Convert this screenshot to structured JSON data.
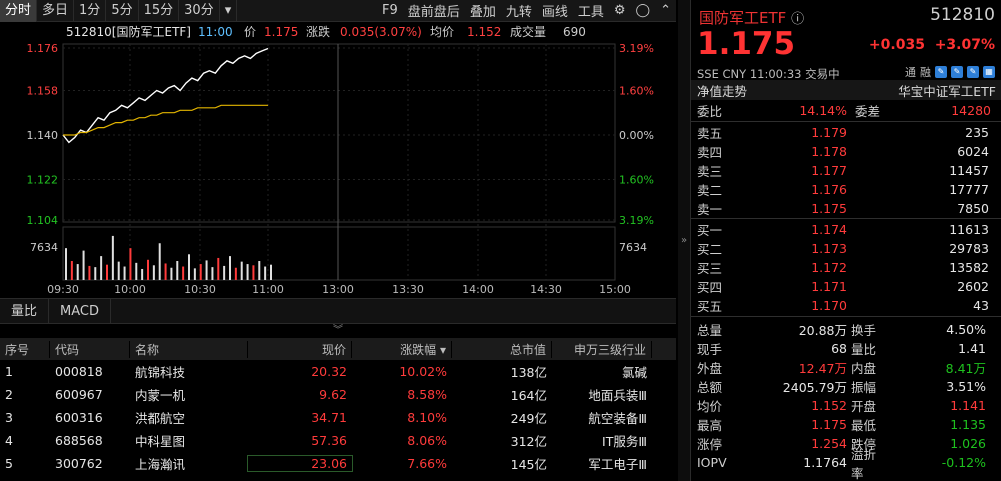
{
  "toolbar": {
    "tabs": [
      "分时",
      "多日",
      "1分",
      "5分",
      "15分",
      "30分"
    ],
    "tools": [
      "F9",
      "盘前盘后",
      "叠加",
      "九转",
      "画线",
      "工具"
    ]
  },
  "chart": {
    "header": {
      "code_name": "512810[国防军工ETF]",
      "time": "11:00",
      "price_label": "价",
      "price": "1.175",
      "chg_label": "涨跌",
      "chg": "0.035(3.07%)",
      "avg_label": "均价",
      "avg": "1.152",
      "vol_label": "成交量",
      "vol": "690"
    },
    "left_ticks": [
      "1.176",
      "1.158",
      "1.140",
      "1.122",
      "1.104"
    ],
    "right_ticks": [
      "3.19%",
      "1.60%",
      "0.00%",
      "1.60%",
      "3.19%"
    ],
    "vol_tick": "7634",
    "x_ticks": [
      "09:30",
      "10:00",
      "10:30",
      "11:00",
      "13:00",
      "13:30",
      "14:00",
      "14:30",
      "15:00"
    ]
  },
  "chart_data": {
    "type": "line",
    "ylim": [
      1.104,
      1.176
    ],
    "series": [
      {
        "name": "价",
        "values": [
          1.14,
          1.137,
          1.139,
          1.142,
          1.141,
          1.144,
          1.147,
          1.146,
          1.149,
          1.15,
          1.152,
          1.151,
          1.153,
          1.155,
          1.154,
          1.156,
          1.158,
          1.157,
          1.159,
          1.16,
          1.158,
          1.161,
          1.163,
          1.162,
          1.165,
          1.166,
          1.165,
          1.168,
          1.17,
          1.169,
          1.171,
          1.172,
          1.171,
          1.173,
          1.174,
          1.175
        ]
      },
      {
        "name": "均价",
        "values": [
          1.14,
          1.14,
          1.14,
          1.141,
          1.141,
          1.142,
          1.143,
          1.143,
          1.144,
          1.145,
          1.145,
          1.146,
          1.146,
          1.147,
          1.147,
          1.148,
          1.148,
          1.149,
          1.149,
          1.149,
          1.15,
          1.15,
          1.15,
          1.151,
          1.151,
          1.151,
          1.151,
          1.152,
          1.152,
          1.152,
          1.152,
          1.152,
          1.152,
          1.152,
          1.152,
          1.152
        ]
      }
    ],
    "volume": [
      5200,
      3100,
      2600,
      4800,
      2300,
      2100,
      3900,
      2500,
      7200,
      3000,
      2200,
      5200,
      2800,
      1800,
      3300,
      2400,
      6000,
      2700,
      2000,
      3100,
      2200,
      4200,
      1900,
      2600,
      3200,
      2100,
      3600,
      2300,
      3900,
      2000,
      3000,
      2600,
      2400,
      3100,
      2200,
      2500
    ]
  },
  "subtabs": [
    "量比",
    "MACD"
  ],
  "table": {
    "headers": [
      "序号",
      "代码",
      "名称",
      "现价",
      "涨跌幅 ▾",
      "总市值",
      "申万三级行业"
    ],
    "rows": [
      [
        "1",
        "000818",
        "航锦科技",
        "20.32",
        "10.02%",
        "138亿",
        "氯碱"
      ],
      [
        "2",
        "600967",
        "内蒙一机",
        "9.62",
        "8.58%",
        "164亿",
        "地面兵装Ⅲ"
      ],
      [
        "3",
        "600316",
        "洪都航空",
        "34.71",
        "8.10%",
        "249亿",
        "航空装备Ⅲ"
      ],
      [
        "4",
        "688568",
        "中科星图",
        "57.36",
        "8.06%",
        "312亿",
        "IT服务Ⅲ"
      ],
      [
        "5",
        "300762",
        "上海瀚讯",
        "23.06",
        "7.66%",
        "145亿",
        "军工电子Ⅲ"
      ]
    ]
  },
  "quote": {
    "name": "国防军工ETF",
    "code": "512810",
    "price": "1.175",
    "change": "+0.035",
    "pct": "+3.07%",
    "info": "SSE  CNY  11:00:33  交易中",
    "icons": [
      "通",
      "融"
    ],
    "section1": {
      "left": "净值走势",
      "right": "华宝中证军工ETF"
    },
    "wb": {
      "l1": "委比",
      "v1": "14.14%",
      "l2": "委差",
      "v2": "14280"
    },
    "asks": [
      [
        "卖五",
        "1.179",
        "235"
      ],
      [
        "卖四",
        "1.178",
        "6024"
      ],
      [
        "卖三",
        "1.177",
        "11457"
      ],
      [
        "卖二",
        "1.176",
        "17777"
      ],
      [
        "卖一",
        "1.175",
        "7850"
      ]
    ],
    "bids": [
      [
        "买一",
        "1.174",
        "11613"
      ],
      [
        "买二",
        "1.173",
        "29783"
      ],
      [
        "买三",
        "1.172",
        "13582"
      ],
      [
        "买四",
        "1.171",
        "2602"
      ],
      [
        "买五",
        "1.170",
        "43"
      ]
    ],
    "stats": [
      [
        "总量",
        "20.88万",
        "换手",
        "4.50%"
      ],
      [
        "现手",
        "68",
        "量比",
        "1.41"
      ],
      [
        "外盘",
        "12.47万",
        "内盘",
        "8.41万"
      ],
      [
        "总额",
        "2405.79万",
        "振幅",
        "3.51%"
      ],
      [
        "均价",
        "1.152",
        "开盘",
        "1.141"
      ],
      [
        "最高",
        "1.175",
        "最低",
        "1.135"
      ],
      [
        "涨停",
        "1.254",
        "跌停",
        "1.026"
      ],
      [
        "IOPV",
        "1.1764",
        "溢折率",
        "-0.12%"
      ]
    ]
  }
}
